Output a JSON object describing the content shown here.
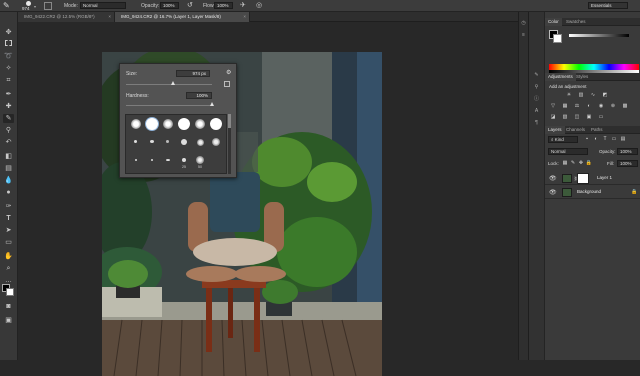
{
  "options_bar": {
    "brush_size": "974",
    "mode_label": "Mode:",
    "mode_value": "Normal",
    "opacity_label": "Opacity:",
    "opacity_value": "100%",
    "flow_label": "Flow:",
    "flow_value": "100%",
    "workspace": "Essentials"
  },
  "tabs": [
    {
      "label": "IMG_9422.CR2 @ 12.5% (RGB/8*)",
      "active": false
    },
    {
      "label": "IMG_9424.CR2 @ 16.7% (Layer 1, Layer Mask/8)",
      "active": true
    }
  ],
  "tab_close_glyph": "×",
  "brush_picker": {
    "size_label": "Size:",
    "size_value": "974 px",
    "hardness_label": "Hardness:",
    "hardness_value": "100%",
    "hardness_level": 1.0,
    "size_level": 0.55,
    "preset_numbers": [
      "25",
      "50"
    ]
  },
  "color_panel": {
    "tabs": [
      "Color",
      "Swatches"
    ],
    "active_tab": 0
  },
  "adjustments_panel": {
    "tabs": [
      "Adjustments",
      "Styles"
    ],
    "active_tab": 0,
    "heading": "Add an adjustment"
  },
  "layers_panel": {
    "tabs": [
      "Layers",
      "Channels",
      "Paths"
    ],
    "active_tab": 0,
    "kind_label": "Kind",
    "blend_mode": "Normal",
    "opacity_label": "Opacity:",
    "opacity_value": "100%",
    "lock_label": "Lock:",
    "fill_label": "Fill:",
    "fill_value": "100%",
    "layers": [
      {
        "name": "Layer 1",
        "selected": true
      },
      {
        "name": "Background",
        "selected": false
      }
    ]
  },
  "colors": {
    "foreground": "#000000",
    "background": "#ffffff",
    "selection": "#4f6b8a"
  }
}
